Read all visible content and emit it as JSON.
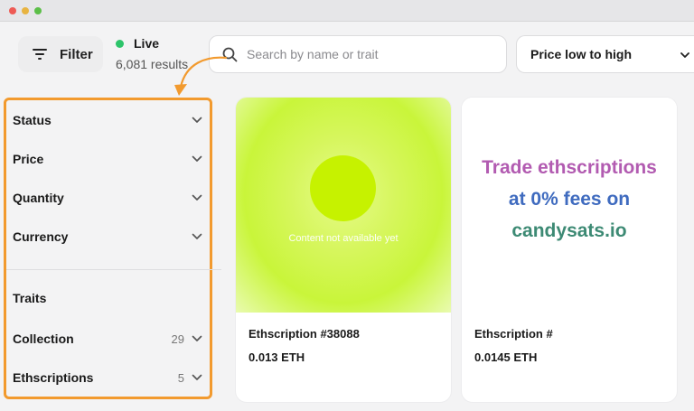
{
  "toolbar": {
    "filter_label": "Filter",
    "live_label": "Live",
    "results": "6,081 results",
    "search_placeholder": "Search by name or trait",
    "sort_selected": "Price low to high"
  },
  "filters": [
    {
      "label": "Status",
      "count": ""
    },
    {
      "label": "Price",
      "count": ""
    },
    {
      "label": "Quantity",
      "count": ""
    },
    {
      "label": "Currency",
      "count": ""
    },
    {
      "label": "Traits",
      "count": ""
    },
    {
      "label": "Collection",
      "count": "29"
    },
    {
      "label": "Ethscriptions",
      "count": "5"
    }
  ],
  "cards": [
    {
      "name": "Ethscription #38088",
      "price": "0.013 ETH",
      "thumb_text": "Content not available yet"
    },
    {
      "name": "Ethscription #",
      "price": "0.0145 ETH",
      "ad_lines": [
        "Trade ethscriptions",
        "at 0% fees on",
        "candysats.io"
      ]
    }
  ],
  "colors": {
    "live_dot": "#2dc46a",
    "highlight": "#f29a2e",
    "thumb_green": "#c6f200"
  },
  "icons": [
    "filter-icon",
    "search-icon",
    "chevron-down-icon",
    "curved-arrow-icon"
  ]
}
